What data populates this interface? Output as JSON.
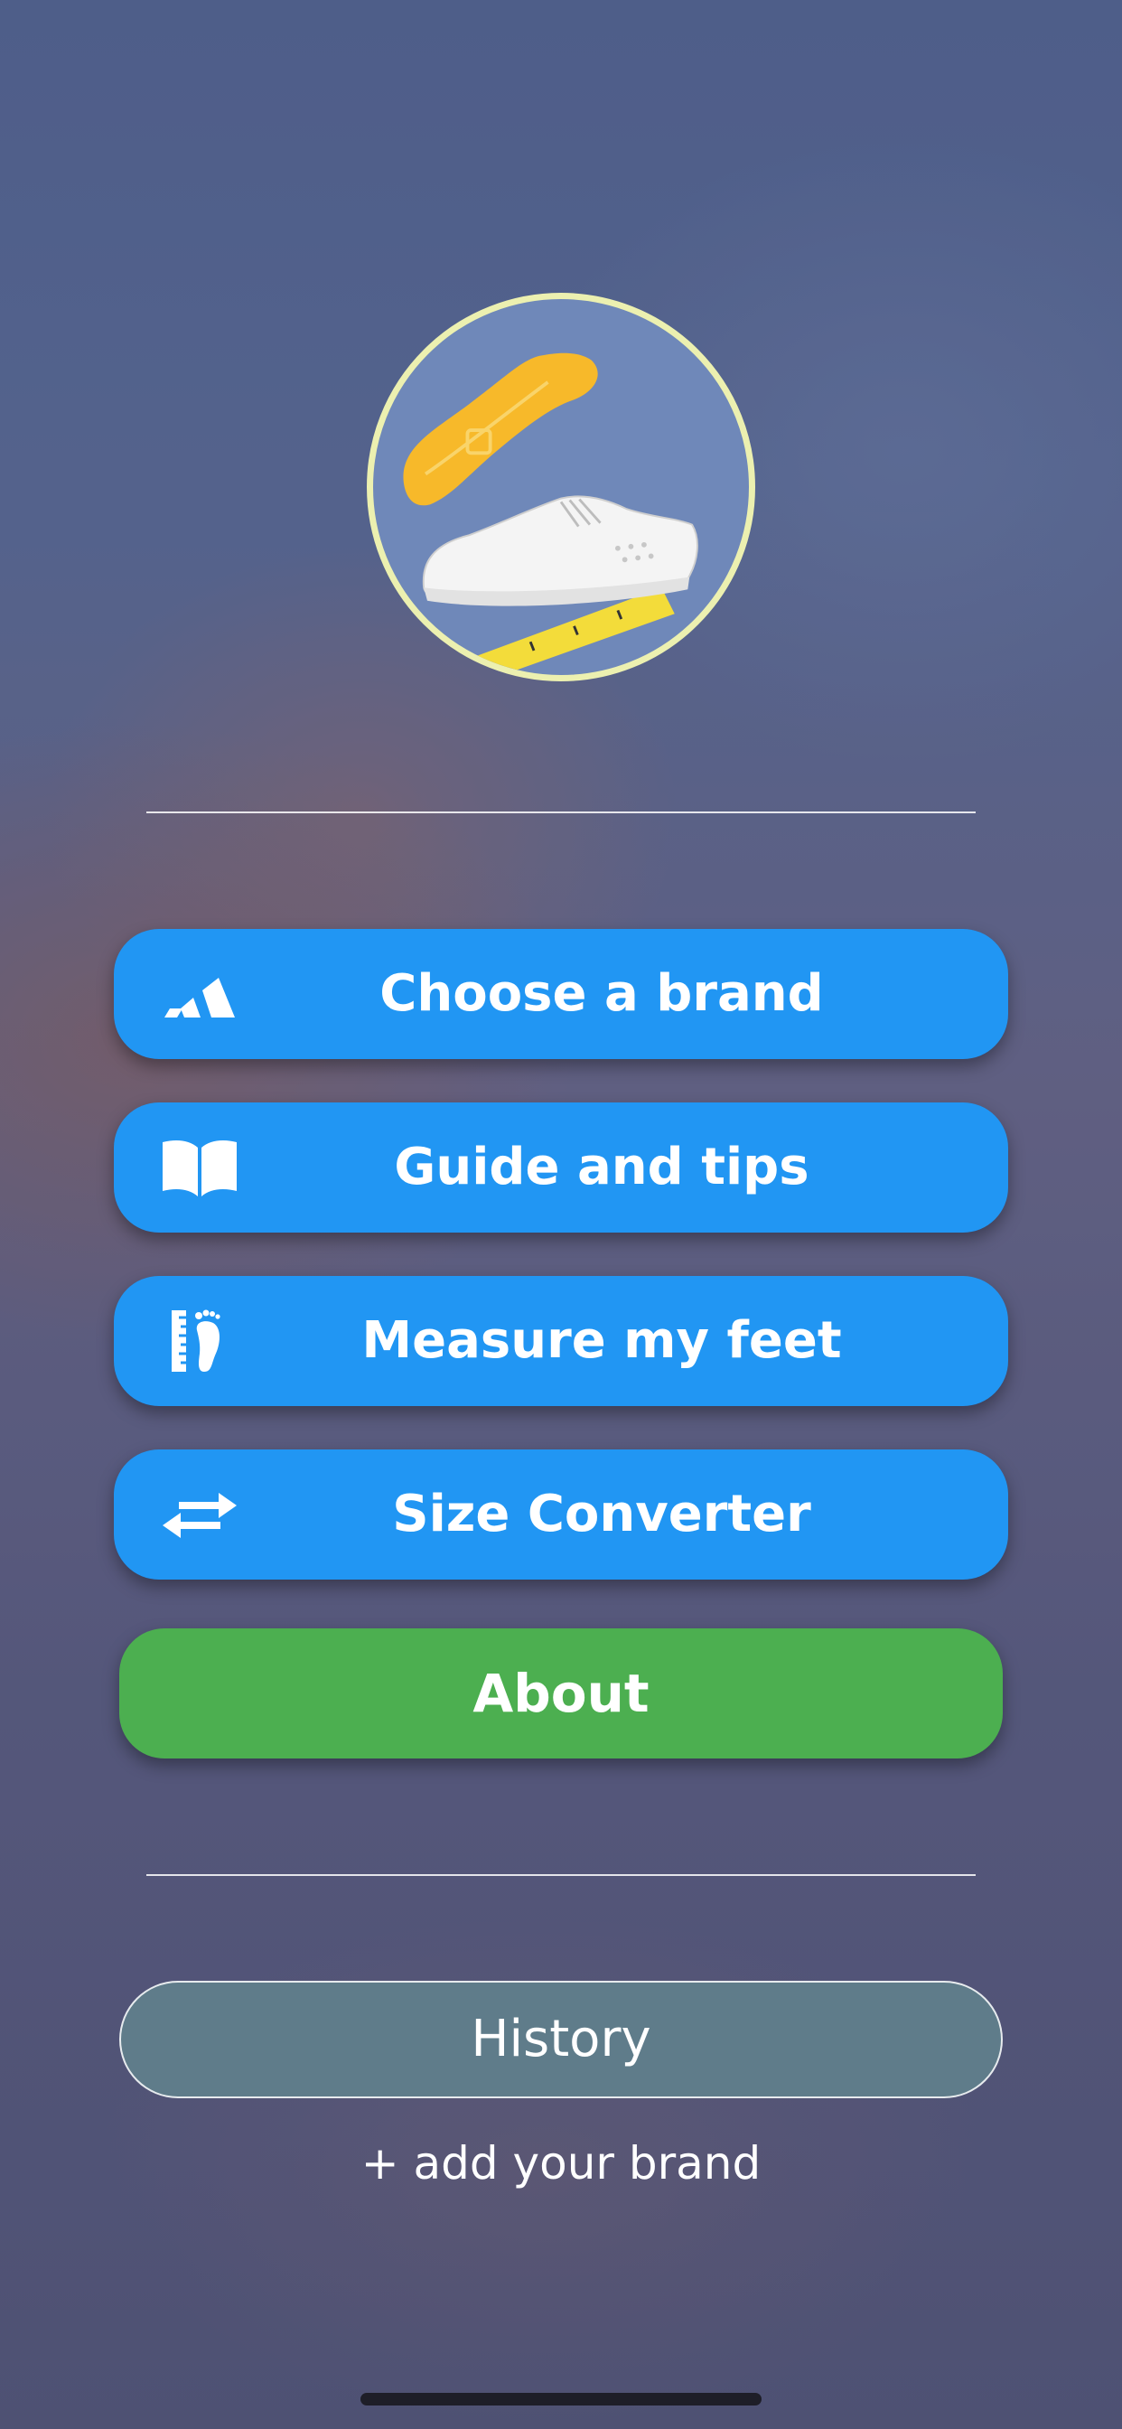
{
  "menu": {
    "choose_brand": "Choose a brand",
    "guide_tips": "Guide and tips",
    "measure_feet": "Measure my feet",
    "size_converter": "Size Converter"
  },
  "about_label": "About",
  "history_label": "History",
  "add_brand_label": "+ add your brand",
  "icons": {
    "choose_brand": "brand-stripes-icon",
    "guide_tips": "open-book-icon",
    "measure_feet": "ruler-foot-icon",
    "size_converter": "swap-arrows-icon"
  },
  "colors": {
    "primary_button": "#2196f3",
    "about_button": "#4caf50",
    "history_button": "#5f7c8a",
    "logo_border": "#ecf0b0"
  }
}
